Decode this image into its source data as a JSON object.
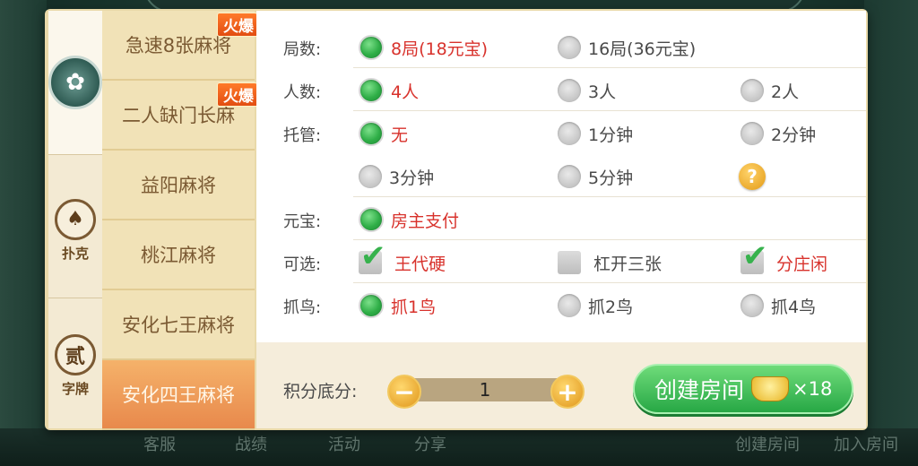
{
  "bottom_bar": [
    "客服",
    "战绩",
    "活动",
    "分享",
    "创建房间",
    "加入房间"
  ],
  "categories": [
    {
      "label": "",
      "icon": "mahjong-flower-emblem-icon"
    },
    {
      "label": "扑克",
      "icon": "spade-icon"
    },
    {
      "label": "字牌",
      "icon": "er-character-icon"
    }
  ],
  "games": [
    {
      "label": "急速8张麻将",
      "badge": "火爆"
    },
    {
      "label": "二人缺门长麻",
      "badge": "火爆"
    },
    {
      "label": "益阳麻将",
      "badge": ""
    },
    {
      "label": "桃江麻将",
      "badge": ""
    },
    {
      "label": "安化七王麻将",
      "badge": ""
    },
    {
      "label": "安化四王麻将",
      "badge": "",
      "selected": true
    }
  ],
  "settings": {
    "rounds": {
      "label": "局数:",
      "options": [
        {
          "text": "8局(18元宝)",
          "selected": true
        },
        {
          "text": "16局(36元宝)",
          "selected": false
        }
      ]
    },
    "players": {
      "label": "人数:",
      "options": [
        {
          "text": "4人",
          "selected": true
        },
        {
          "text": "3人",
          "selected": false
        },
        {
          "text": "2人",
          "selected": false
        }
      ]
    },
    "hosting": {
      "label": "托管:",
      "options": [
        {
          "text": "无",
          "selected": true
        },
        {
          "text": "1分钟",
          "selected": false
        },
        {
          "text": "2分钟",
          "selected": false
        },
        {
          "text": "3分钟",
          "selected": false
        },
        {
          "text": "5分钟",
          "selected": false
        }
      ]
    },
    "payment": {
      "label": "元宝:",
      "options": [
        {
          "text": "房主支付",
          "selected": true
        }
      ]
    },
    "optional": {
      "label": "可选:",
      "options": [
        {
          "text": "王代硬",
          "checked": true
        },
        {
          "text": "杠开三张",
          "checked": false
        },
        {
          "text": "分庄闲",
          "checked": true
        }
      ]
    },
    "birds": {
      "label": "抓鸟:",
      "options": [
        {
          "text": "抓1鸟",
          "selected": true
        },
        {
          "text": "抓2鸟",
          "selected": false
        },
        {
          "text": "抓4鸟",
          "selected": false
        }
      ]
    }
  },
  "footer": {
    "score_label": "积分底分:",
    "score_value": "1",
    "create_label": "创建房间",
    "cost": "×18"
  },
  "colors": {
    "accent_red": "#d8322c",
    "radio_green": "#2fae47",
    "button_green": "#27a845"
  }
}
